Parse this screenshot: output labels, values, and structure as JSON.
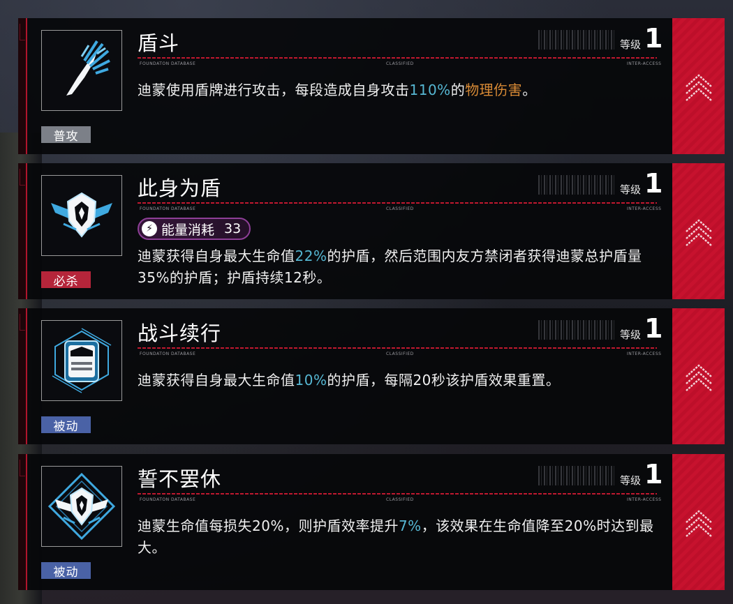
{
  "level_label": "等级",
  "meta": {
    "left": "FOUNDATON DATABASE",
    "center": "CLASSIFIED",
    "right": "INTER-ACCESS"
  },
  "skills": [
    {
      "name": "盾斗",
      "level": "1",
      "tag": "普攻",
      "tag_color": "#7c8088",
      "icon": "slash-strike-icon",
      "desc": {
        "p1": "迪蒙使用盾牌进行攻击，每段造成自身攻击",
        "pct": "110%",
        "p2": "的",
        "dmg": "物理伤害",
        "p3": "。"
      }
    },
    {
      "name": "此身为盾",
      "level": "1",
      "tag": "必杀",
      "tag_color": "#b5253a",
      "icon": "winged-shield-icon",
      "energy": {
        "label": "能量消耗",
        "value": "33"
      },
      "desc": {
        "p1": "迪蒙获得自身最大生命值",
        "pct": "22%",
        "p2": "的护盾，然后范围内友方禁闭者获得迪蒙总护盾量35%的护盾；护盾持续12秒。"
      }
    },
    {
      "name": "战斗续行",
      "level": "1",
      "tag": "被动",
      "tag_color": "#4a62a6",
      "icon": "armor-shield-icon",
      "desc": {
        "p1": "迪蒙获得自身最大生命值",
        "pct": "10%",
        "p2": "的护盾，每隔20秒该护盾效果重置。"
      }
    },
    {
      "name": "誓不罢休",
      "level": "1",
      "tag": "被动",
      "tag_color": "#4a62a6",
      "icon": "diamond-shield-icon",
      "desc": {
        "p1": "迪蒙生命值每损失20%，则护盾效率提升",
        "pct": "7%",
        "p2": "，该效果在生命值降至20%时达到最大。"
      }
    }
  ],
  "colors": {
    "accent_red": "#c7122e",
    "highlight_cyan": "#56b7d3",
    "highlight_orange": "#d88a35",
    "energy_purple": "#8e3f97"
  }
}
